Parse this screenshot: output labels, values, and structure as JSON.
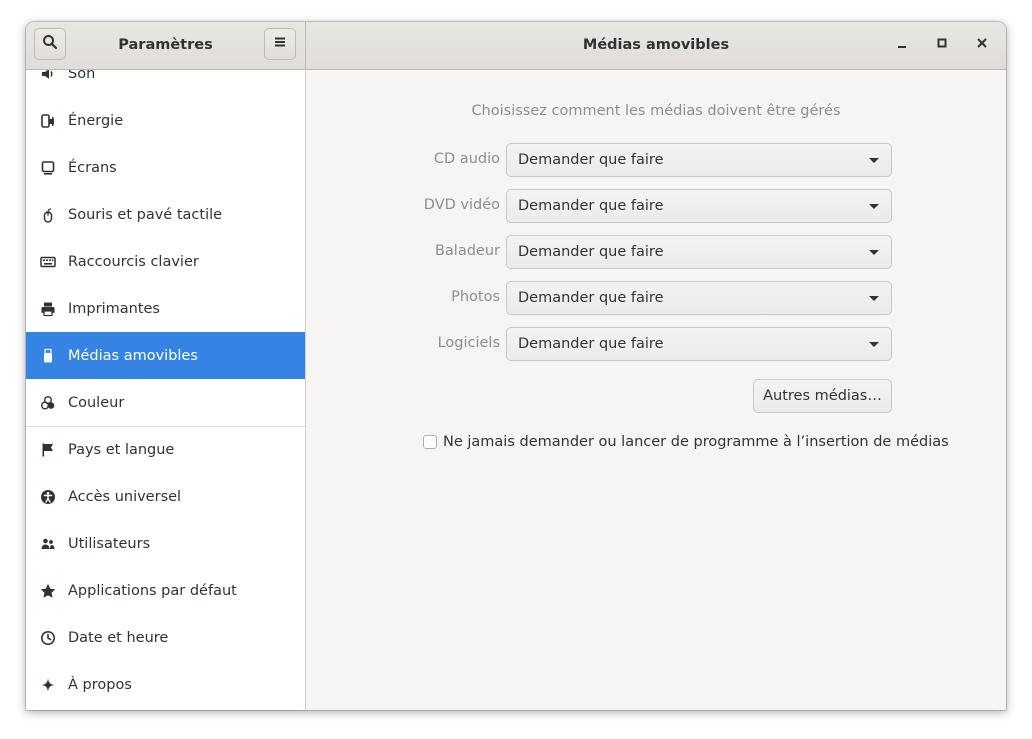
{
  "window": {
    "sidebar_title": "Paramètres",
    "page_title": "Médias amovibles",
    "search_icon": "search-icon",
    "menu_icon": "hamburger-menu-icon"
  },
  "sidebar": {
    "items": [
      {
        "label": "Son",
        "icon": "speaker-icon"
      },
      {
        "label": "Énergie",
        "icon": "power-plug-icon"
      },
      {
        "label": "Écrans",
        "icon": "display-icon"
      },
      {
        "label": "Souris et pavé tactile",
        "icon": "mouse-icon"
      },
      {
        "label": "Raccourcis clavier",
        "icon": "keyboard-icon"
      },
      {
        "label": "Imprimantes",
        "icon": "printer-icon"
      },
      {
        "label": "Médias amovibles",
        "icon": "usb-media-icon",
        "active": true
      },
      {
        "label": "Couleur",
        "icon": "color-circles-icon"
      },
      {
        "label": "Pays et langue",
        "icon": "flag-icon"
      },
      {
        "label": "Accès universel",
        "icon": "accessibility-icon"
      },
      {
        "label": "Utilisateurs",
        "icon": "users-icon"
      },
      {
        "label": "Applications par défaut",
        "icon": "star-icon"
      },
      {
        "label": "Date et heure",
        "icon": "clock-icon"
      },
      {
        "label": "À propos",
        "icon": "sparkle-icon"
      }
    ]
  },
  "main": {
    "heading": "Choisissez comment les médias doivent être gérés",
    "rows": [
      {
        "label": "CD audio",
        "value": "Demander que faire"
      },
      {
        "label": "DVD vidéo",
        "value": "Demander que faire"
      },
      {
        "label": "Baladeur",
        "value": "Demander que faire"
      },
      {
        "label": "Photos",
        "value": "Demander que faire"
      },
      {
        "label": "Logiciels",
        "value": "Demander que faire"
      }
    ],
    "other_button": "Autres médias…",
    "never_ask_label": "Ne jamais demander ou lancer de programme à l’insertion de médias",
    "never_ask_checked": false
  },
  "colors": {
    "accent": "#3584e4",
    "dim_text": "#8b8e8f"
  }
}
